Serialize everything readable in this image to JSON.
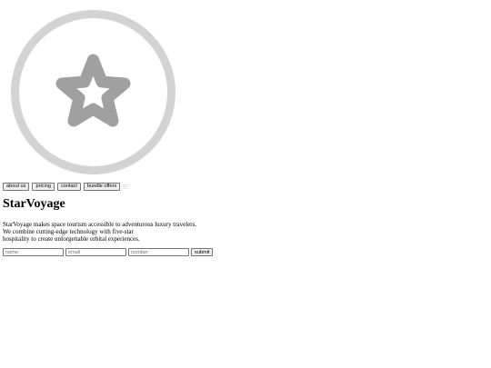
{
  "logo": {
    "icon": "star-icon",
    "ring_color": "#d3d3d3",
    "star_color": "#a0a0a0"
  },
  "nav": {
    "items": [
      {
        "label": "about us"
      },
      {
        "label": "pricing"
      },
      {
        "label": "contact"
      },
      {
        "label": "bundle offers"
      }
    ],
    "extra_icon": "menu-icon"
  },
  "hero": {
    "title": "StarVoyage",
    "description_lines": [
      "StarVoyage makes space tourism accessible to adventurous luxury travelers.",
      "We combine cutting-edge technology with five-star",
      "hospitality to create unforgettable orbital experiences."
    ]
  },
  "form": {
    "name_placeholder": "name",
    "email_placeholder": "email",
    "number_placeholder": "number",
    "submit_label": "submit"
  }
}
